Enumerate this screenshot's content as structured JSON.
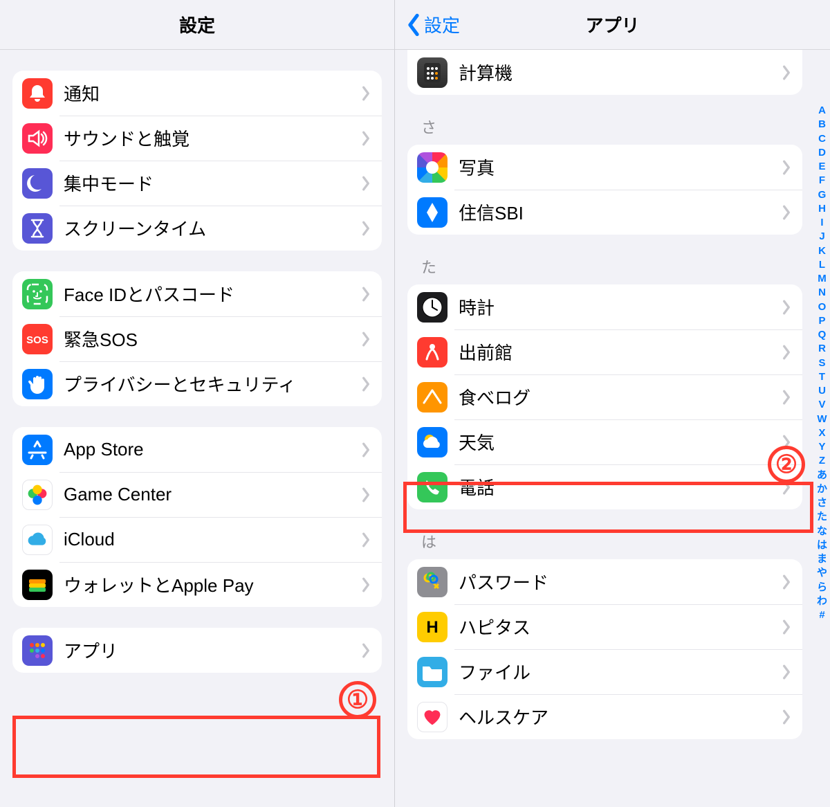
{
  "left": {
    "title": "設定",
    "groups": [
      {
        "items": [
          {
            "id": "notifications",
            "label": "通知",
            "icon": "bell",
            "bg": "bg-red"
          },
          {
            "id": "sound",
            "label": "サウンドと触覚",
            "icon": "speaker",
            "bg": "bg-pink"
          },
          {
            "id": "focus",
            "label": "集中モード",
            "icon": "moon",
            "bg": "bg-indigo"
          },
          {
            "id": "screentime",
            "label": "スクリーンタイム",
            "icon": "hourglass",
            "bg": "bg-indigo"
          }
        ]
      },
      {
        "items": [
          {
            "id": "faceid",
            "label": "Face IDとパスコード",
            "icon": "faceid",
            "bg": "bg-green"
          },
          {
            "id": "sos",
            "label": "緊急SOS",
            "icon": "sos",
            "bg": "bg-red"
          },
          {
            "id": "privacy",
            "label": "プライバシーとセキュリティ",
            "icon": "hand",
            "bg": "bg-blue"
          }
        ]
      },
      {
        "items": [
          {
            "id": "appstore",
            "label": "App Store",
            "icon": "appstore",
            "bg": "bg-blue"
          },
          {
            "id": "gamecenter",
            "label": "Game Center",
            "icon": "gamectr",
            "bg": "bg-white"
          },
          {
            "id": "icloud",
            "label": "iCloud",
            "icon": "icloud",
            "bg": "bg-white"
          },
          {
            "id": "wallet",
            "label": "ウォレットとApple Pay",
            "icon": "wallet",
            "bg": "bg-wallet"
          }
        ]
      },
      {
        "items": [
          {
            "id": "apps",
            "label": "アプリ",
            "icon": "apps",
            "bg": "bg-indigo"
          }
        ]
      }
    ],
    "annotation": {
      "label": "①"
    }
  },
  "right": {
    "title": "アプリ",
    "back": "設定",
    "sections": [
      {
        "header": null,
        "items": [
          {
            "id": "calculator",
            "label": "計算機",
            "icon": "calc",
            "bg": "bg-calc"
          }
        ]
      },
      {
        "header": "さ",
        "items": [
          {
            "id": "photos",
            "label": "写真",
            "icon": "photos",
            "bg": "photos"
          },
          {
            "id": "sbi",
            "label": "住信SBI",
            "icon": "sbi",
            "bg": "bg-blue"
          }
        ]
      },
      {
        "header": "た",
        "items": [
          {
            "id": "clock",
            "label": "時計",
            "icon": "clock",
            "bg": "bg-black"
          },
          {
            "id": "demaecan",
            "label": "出前館",
            "icon": "demae",
            "bg": "bg-red"
          },
          {
            "id": "tabelog",
            "label": "食べログ",
            "icon": "tabelog",
            "bg": "bg-orange"
          },
          {
            "id": "weather",
            "label": "天気",
            "icon": "weather",
            "bg": "bg-blue"
          },
          {
            "id": "phone",
            "label": "電話",
            "icon": "phone",
            "bg": "bg-green"
          }
        ]
      },
      {
        "header": "は",
        "items": [
          {
            "id": "passwords",
            "label": "パスワード",
            "icon": "keys",
            "bg": "bg-gray"
          },
          {
            "id": "hapitas",
            "label": "ハピタス",
            "icon": "hapitas",
            "bg": "bg-yellow"
          },
          {
            "id": "files",
            "label": "ファイル",
            "icon": "folder",
            "bg": "bg-cyan"
          },
          {
            "id": "health",
            "label": "ヘルスケア",
            "icon": "heart",
            "bg": "bg-white"
          }
        ]
      }
    ],
    "index": [
      "A",
      "B",
      "C",
      "D",
      "E",
      "F",
      "G",
      "H",
      "I",
      "J",
      "K",
      "L",
      "M",
      "N",
      "O",
      "P",
      "Q",
      "R",
      "S",
      "T",
      "U",
      "V",
      "W",
      "X",
      "Y",
      "Z",
      "あ",
      "か",
      "さ",
      "た",
      "な",
      "は",
      "ま",
      "や",
      "ら",
      "わ",
      "#"
    ],
    "annotation": {
      "label": "②"
    }
  }
}
